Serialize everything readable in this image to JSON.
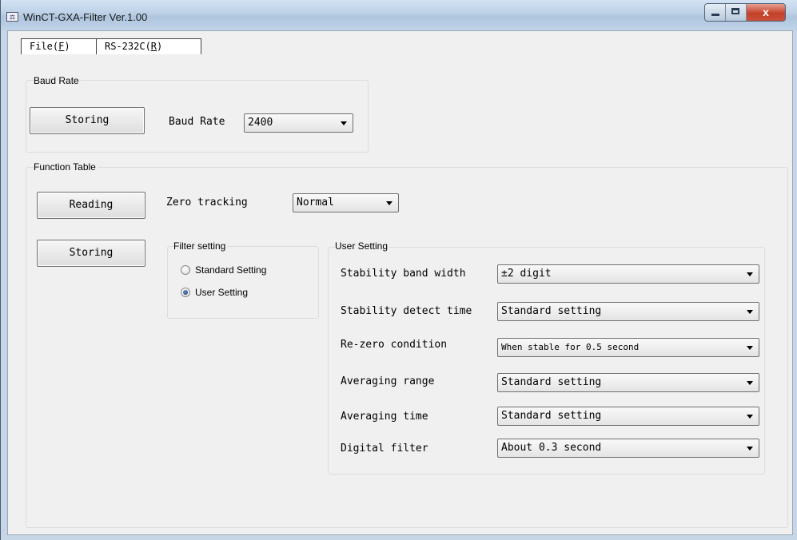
{
  "window": {
    "title": "WinCT-GXA-Filter Ver.1.00",
    "app_icon_text": "⚖",
    "close_glyph": "x"
  },
  "menu": [
    {
      "label": "File(",
      "mnemonic": "F",
      "suffix": ")"
    },
    {
      "label": "RS-232C(",
      "mnemonic": "R",
      "suffix": ")"
    }
  ],
  "baud_group": {
    "title": "Baud Rate",
    "storing_button": "Storing",
    "baud_label": "Baud Rate",
    "baud_value": "2400"
  },
  "function_group": {
    "title": "Function Table",
    "reading_button": "Reading",
    "storing_button": "Storing",
    "zero_tracking_label": "Zero tracking",
    "zero_tracking_value": "Normal",
    "filter_setting": {
      "title": "Filter setting",
      "options": [
        {
          "label": "Standard Setting",
          "checked": false
        },
        {
          "label": "User Setting",
          "checked": true
        }
      ]
    },
    "user_setting": {
      "title": "User Setting",
      "rows": [
        {
          "label": "Stability band width",
          "value": "±2 digit"
        },
        {
          "label": "Stability detect time",
          "value": "Standard setting"
        },
        {
          "label": "Re-zero condition",
          "value": "When stable for 0.5 second"
        },
        {
          "label": "Averaging range",
          "value": "Standard setting"
        },
        {
          "label": "Averaging time",
          "value": "Standard setting"
        },
        {
          "label": "Digital filter",
          "value": "About 0.3 second"
        }
      ]
    }
  }
}
